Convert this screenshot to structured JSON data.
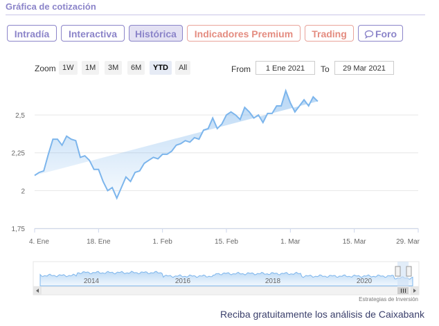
{
  "section_title": "Gráfica de cotización",
  "tabs": [
    {
      "label": "Intradía",
      "style": "purple"
    },
    {
      "label": "Interactiva",
      "style": "purple"
    },
    {
      "label": "Histórica",
      "style": "purple-active"
    },
    {
      "label": "Indicadores Premium",
      "style": "salmon"
    },
    {
      "label": "Trading",
      "style": "salmon"
    },
    {
      "label": "Foro",
      "style": "purple",
      "icon": "chat-bubble-icon"
    }
  ],
  "zoom": {
    "label": "Zoom",
    "buttons": [
      "1W",
      "1M",
      "3M",
      "6M",
      "YTD",
      "All"
    ],
    "active": "YTD"
  },
  "range": {
    "from_label": "From",
    "from_value": "1 Ene 2021",
    "to_label": "To",
    "to_value": "29 Mar 2021"
  },
  "credit": "Estrategias de Inversión",
  "promo": "Reciba gratuitamente los análisis de Caixabank",
  "colors": {
    "line": "#7cb5ec",
    "accent_purple": "#8b84c9",
    "accent_salmon": "#e48c80"
  },
  "chart_data": {
    "type": "area",
    "y_ticks": [
      "1,75",
      "2",
      "2,25",
      "2,5"
    ],
    "y_tick_values": [
      1.75,
      2.0,
      2.25,
      2.5
    ],
    "ylim": [
      1.75,
      2.72
    ],
    "x_ticks": [
      {
        "label": "4. Ene",
        "day": 4
      },
      {
        "label": "18. Ene",
        "day": 18
      },
      {
        "label": "1. Feb",
        "day": 32
      },
      {
        "label": "15. Feb",
        "day": 46
      },
      {
        "label": "1. Mar",
        "day": 60
      },
      {
        "label": "15. Mar",
        "day": 74
      },
      {
        "label": "29. Mar",
        "day": 88
      }
    ],
    "xlim_days": [
      4,
      88
    ],
    "series": [
      {
        "days": [
          4,
          5,
          6,
          7,
          8,
          9,
          10,
          11,
          12,
          13,
          14,
          15,
          16,
          17,
          18,
          19,
          20,
          21,
          22,
          23,
          24,
          25,
          26,
          27,
          28,
          29,
          30,
          31,
          32,
          33,
          34,
          35,
          36,
          37,
          38,
          39,
          40,
          41,
          42,
          43,
          44,
          45,
          46,
          47,
          48,
          49,
          50,
          51,
          52,
          53,
          54,
          55,
          56,
          57,
          58,
          59,
          60,
          61,
          62,
          63,
          64,
          65,
          66,
          67,
          68,
          69,
          70,
          71,
          72,
          73,
          74,
          75,
          76,
          77,
          78,
          79,
          80,
          81,
          82,
          83,
          84,
          85,
          86,
          87,
          88
        ],
        "values": [
          2.1,
          2.12,
          2.13,
          2.24,
          2.34,
          2.34,
          2.3,
          2.36,
          2.34,
          2.33,
          2.22,
          2.23,
          2.2,
          2.14,
          2.14,
          2.06,
          2.0,
          2.02,
          1.95,
          2.02,
          2.09,
          2.06,
          2.12,
          2.13,
          2.18,
          2.2,
          2.22,
          2.21,
          2.24,
          2.24,
          2.26,
          2.3,
          2.31,
          2.33,
          2.32,
          2.35,
          2.34,
          2.4,
          2.41,
          2.48,
          2.41,
          2.44,
          2.5,
          2.52,
          2.5,
          2.47,
          2.55,
          2.52,
          2.48,
          2.5,
          2.45,
          2.51,
          2.51,
          2.56,
          2.56,
          2.66,
          2.58,
          2.52,
          2.56,
          2.6,
          2.56,
          2.62,
          2.59
        ]
      }
    ],
    "navigator": {
      "year_labels": [
        "2014",
        "2016",
        "2018",
        "2020"
      ]
    }
  }
}
